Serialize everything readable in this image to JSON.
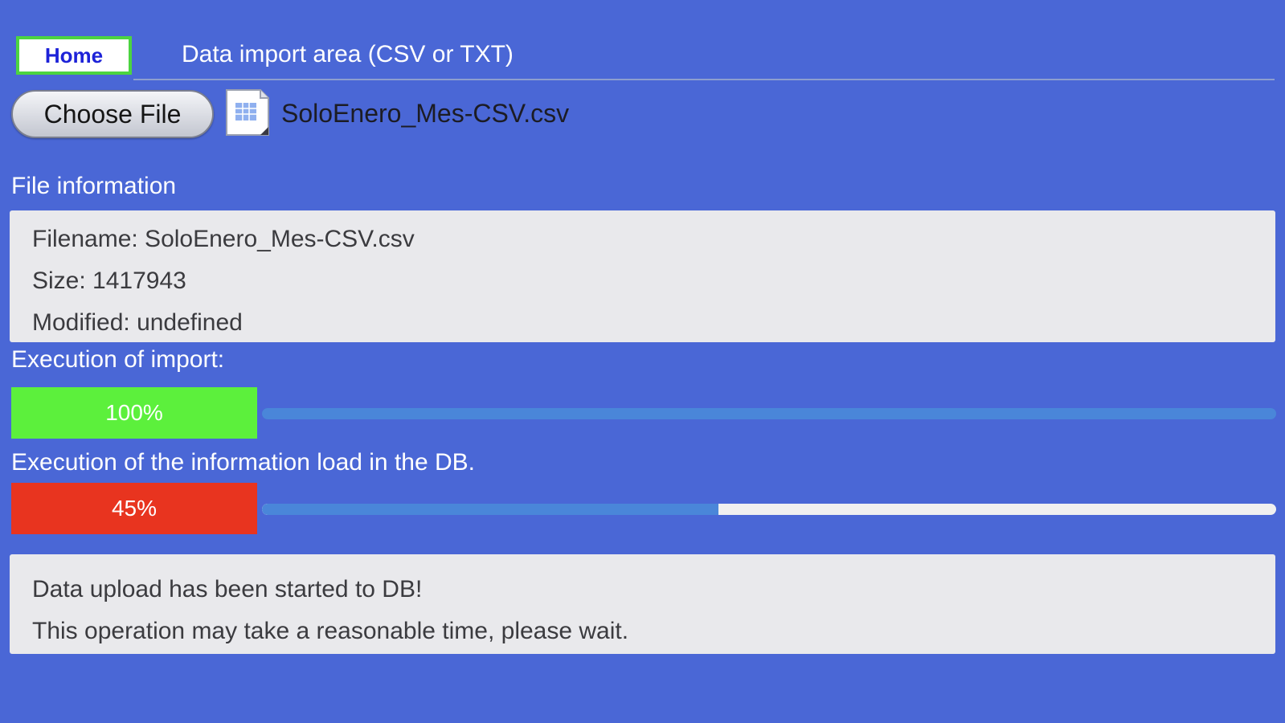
{
  "header": {
    "home_label": "Home",
    "area_title": "Data import area (CSV or TXT)"
  },
  "file_picker": {
    "button_label": "Choose File",
    "chosen_file": "SoloEnero_Mes-CSV.csv",
    "file_icon": "spreadsheet-file-icon"
  },
  "file_info": {
    "title": "File information",
    "filename_line": "Filename: SoloEnero_Mes-CSV.csv",
    "size_line": "Size: 1417943",
    "modified_line": "Modified: undefined"
  },
  "import_progress": {
    "label": "Execution of import:",
    "percent_text": "100%",
    "fraction": 1.0,
    "badge_color": "#5cf03c",
    "track_color": "#3f78d1"
  },
  "db_progress": {
    "label": "Execution of the information load in the DB.",
    "percent_text": "45%",
    "fraction": 0.45,
    "badge_color": "#e8341f",
    "track_color": "#f0f0f0"
  },
  "status": {
    "line1": "Data upload has been started to DB!",
    "line2": "This operation may take a reasonable time, please wait."
  },
  "colors": {
    "background": "#4a67d6",
    "home_border": "#4cd440",
    "home_text": "#1d22d8"
  }
}
